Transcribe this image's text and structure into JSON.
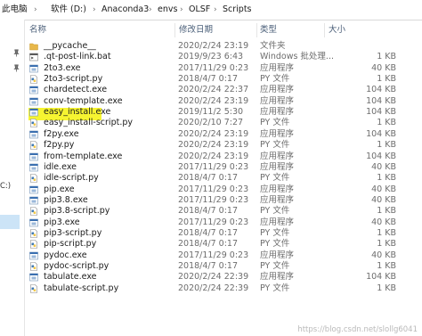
{
  "breadcrumb": [
    {
      "label": "此电脑"
    },
    {
      "label": "软件 (D:)"
    },
    {
      "label": "Anaconda3"
    },
    {
      "label": "envs"
    },
    {
      "label": "OLSF"
    },
    {
      "label": "Scripts"
    }
  ],
  "nav_pane": {
    "drive_label": "C:)"
  },
  "columns": {
    "name": "名称",
    "date": "修改日期",
    "type": "类型",
    "size": "大小"
  },
  "files": [
    {
      "icon": "folder-icon",
      "name": "__pycache__",
      "date": "2020/2/24 23:19",
      "type": "文件夹",
      "size": ""
    },
    {
      "icon": "bat-file-icon",
      "name": ".qt-post-link.bat",
      "date": "2019/9/23 6:43",
      "type": "Windows 批处理...",
      "size": "1 KB"
    },
    {
      "icon": "exe-file-icon",
      "name": "2to3.exe",
      "date": "2017/11/29 0:23",
      "type": "应用程序",
      "size": "40 KB"
    },
    {
      "icon": "python-file-icon",
      "name": "2to3-script.py",
      "date": "2018/4/7 0:17",
      "type": "PY 文件",
      "size": "1 KB"
    },
    {
      "icon": "exe-file-icon",
      "name": "chardetect.exe",
      "date": "2020/2/24 22:37",
      "type": "应用程序",
      "size": "104 KB"
    },
    {
      "icon": "exe-file-icon",
      "name": "conv-template.exe",
      "date": "2020/2/24 23:19",
      "type": "应用程序",
      "size": "104 KB"
    },
    {
      "icon": "exe-file-icon",
      "name": "easy_install.exe",
      "date": "2019/11/2 5:30",
      "type": "应用程序",
      "size": "104 KB",
      "highlighted": true
    },
    {
      "icon": "python-file-icon",
      "name": "easy_install-script.py",
      "date": "2020/2/10 7:27",
      "type": "PY 文件",
      "size": "1 KB"
    },
    {
      "icon": "exe-file-icon",
      "name": "f2py.exe",
      "date": "2020/2/24 23:19",
      "type": "应用程序",
      "size": "104 KB"
    },
    {
      "icon": "python-file-icon",
      "name": "f2py.py",
      "date": "2020/2/24 23:19",
      "type": "PY 文件",
      "size": "1 KB"
    },
    {
      "icon": "exe-file-icon",
      "name": "from-template.exe",
      "date": "2020/2/24 23:19",
      "type": "应用程序",
      "size": "104 KB"
    },
    {
      "icon": "exe-file-icon",
      "name": "idle.exe",
      "date": "2017/11/29 0:23",
      "type": "应用程序",
      "size": "40 KB"
    },
    {
      "icon": "python-file-icon",
      "name": "idle-script.py",
      "date": "2018/4/7 0:17",
      "type": "PY 文件",
      "size": "1 KB"
    },
    {
      "icon": "exe-file-icon",
      "name": "pip.exe",
      "date": "2017/11/29 0:23",
      "type": "应用程序",
      "size": "40 KB"
    },
    {
      "icon": "exe-file-icon",
      "name": "pip3.8.exe",
      "date": "2017/11/29 0:23",
      "type": "应用程序",
      "size": "40 KB"
    },
    {
      "icon": "python-file-icon",
      "name": "pip3.8-script.py",
      "date": "2018/4/7 0:17",
      "type": "PY 文件",
      "size": "1 KB"
    },
    {
      "icon": "exe-file-icon",
      "name": "pip3.exe",
      "date": "2017/11/29 0:23",
      "type": "应用程序",
      "size": "40 KB"
    },
    {
      "icon": "python-file-icon",
      "name": "pip3-script.py",
      "date": "2018/4/7 0:17",
      "type": "PY 文件",
      "size": "1 KB"
    },
    {
      "icon": "python-file-icon",
      "name": "pip-script.py",
      "date": "2018/4/7 0:17",
      "type": "PY 文件",
      "size": "1 KB"
    },
    {
      "icon": "exe-file-icon",
      "name": "pydoc.exe",
      "date": "2017/11/29 0:23",
      "type": "应用程序",
      "size": "40 KB"
    },
    {
      "icon": "python-file-icon",
      "name": "pydoc-script.py",
      "date": "2018/4/7 0:17",
      "type": "PY 文件",
      "size": "1 KB"
    },
    {
      "icon": "exe-file-icon",
      "name": "tabulate.exe",
      "date": "2020/2/24 22:39",
      "type": "应用程序",
      "size": "104 KB"
    },
    {
      "icon": "python-file-icon",
      "name": "tabulate-script.py",
      "date": "2020/2/24 22:39",
      "type": "PY 文件",
      "size": "1 KB"
    }
  ],
  "watermark": "https://blog.csdn.net/slollg6041",
  "colors": {
    "highlight": "#f6f431",
    "selection": "#cce4f7",
    "folder": "#e8b84a",
    "exe": "#3a6fb0",
    "python": "#3c78b4"
  }
}
